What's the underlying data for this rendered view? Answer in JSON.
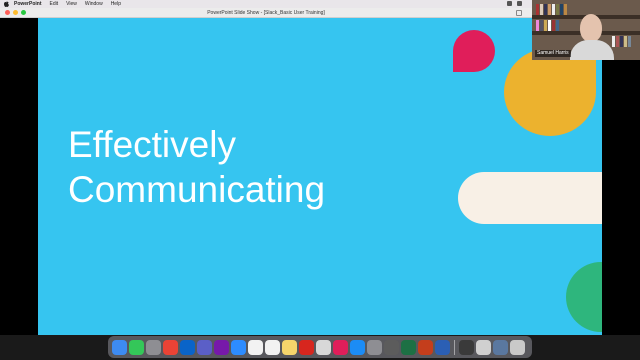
{
  "menubar": {
    "items": [
      "PowerPoint",
      "Edit",
      "View",
      "Window",
      "Help"
    ]
  },
  "window": {
    "title": "PowerPoint Slide Show - [Slack_Basic User Training]"
  },
  "slide": {
    "title_lines": [
      "Effectively",
      "Communicating"
    ],
    "colors": {
      "background": "#36c5f0",
      "red": "#e01e5a",
      "yellow": "#ecb22e",
      "cream": "#f8f0e6",
      "green": "#2eb67d"
    }
  },
  "webcam": {
    "name": "Samuel Harris"
  },
  "dock": {
    "apps": [
      {
        "name": "finder-icon",
        "color": "#3d8bf2"
      },
      {
        "name": "messages-icon",
        "color": "#34c759"
      },
      {
        "name": "launchpad-icon",
        "color": "#8e8e93"
      },
      {
        "name": "chrome-icon",
        "color": "#ea4335"
      },
      {
        "name": "outlook-icon",
        "color": "#0a64c9"
      },
      {
        "name": "teams-icon",
        "color": "#5b5fc7"
      },
      {
        "name": "onenote-icon",
        "color": "#7719aa"
      },
      {
        "name": "zoom-icon",
        "color": "#2d8cff"
      },
      {
        "name": "calendar-icon",
        "color": "#f2f2f2"
      },
      {
        "name": "reminders-icon",
        "color": "#f2f2f2"
      },
      {
        "name": "notes-icon",
        "color": "#f6d56b"
      },
      {
        "name": "acrobat-icon",
        "color": "#d7261e"
      },
      {
        "name": "photo-app-icon",
        "color": "#d8d8d8"
      },
      {
        "name": "slack-red-icon",
        "color": "#e01e5a"
      },
      {
        "name": "app-store-icon",
        "color": "#1c8cf5"
      },
      {
        "name": "system-preferences-icon",
        "color": "#8e8e93"
      },
      {
        "name": "disk-utility-icon",
        "color": "#5c5c5c"
      },
      {
        "name": "excel-icon",
        "color": "#1d7044"
      },
      {
        "name": "powerpoint-icon",
        "color": "#c43e1c"
      },
      {
        "name": "word-icon",
        "color": "#2b5fb4"
      }
    ],
    "recents": [
      {
        "name": "preview-window-icon",
        "color": "#3a3a3a"
      },
      {
        "name": "downloads-stack-icon",
        "color": "#d0d0d0"
      },
      {
        "name": "documents-stack-icon",
        "color": "#5a78a0"
      },
      {
        "name": "trash-icon",
        "color": "#c9c9c9"
      }
    ]
  }
}
